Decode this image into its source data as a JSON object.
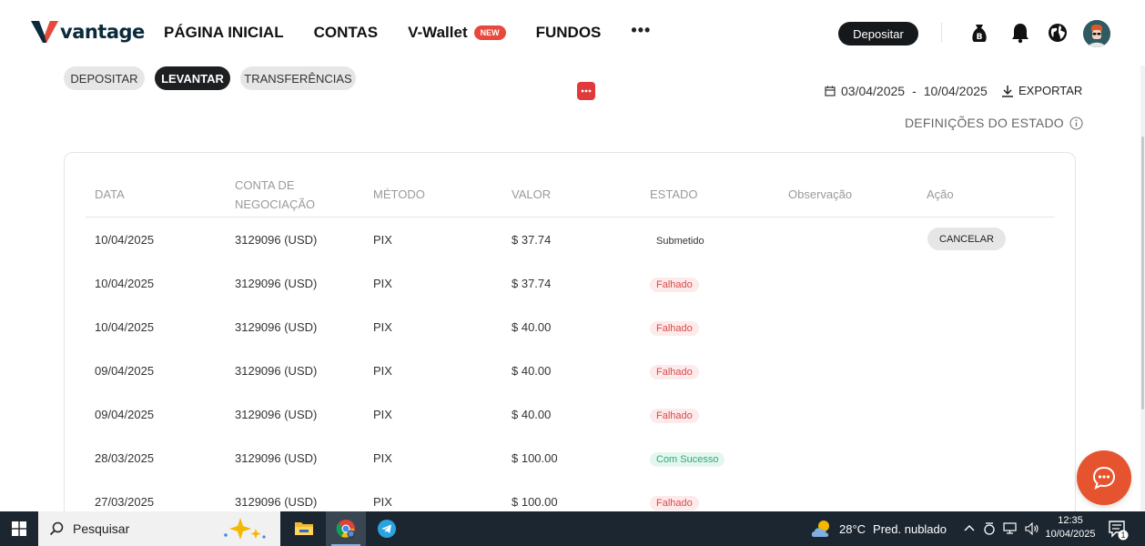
{
  "brand": {
    "logo_text": "vantage",
    "logo_color": "#0b2a3c",
    "accent": "#e8493d"
  },
  "nav": {
    "items": [
      {
        "label": "PÁGINA INICIAL"
      },
      {
        "label": "CONTAS"
      },
      {
        "label": "V-Wallet",
        "badge": "NEW"
      },
      {
        "label": "FUNDOS"
      }
    ],
    "more_label": "•••",
    "deposit_button": "Depositar",
    "icons": [
      "bonus-bag-icon",
      "bell-icon",
      "globe-icon",
      "avatar"
    ]
  },
  "tabs": [
    {
      "label": "DEPOSITAR",
      "active": false
    },
    {
      "label": "LEVANTAR",
      "active": true
    },
    {
      "label": "TRANSFERÊNCIAS",
      "active": false
    }
  ],
  "filters": {
    "date_from": "03/04/2025",
    "date_sep": "-",
    "date_to": "10/04/2025",
    "export_label": "EXPORTAR",
    "status_definitions_label": "DEFINIÇÕES DO ESTADO"
  },
  "table": {
    "headers": {
      "date": "DATA",
      "account_line1": "CONTA DE",
      "account_line2": "NEGOCIAÇÃO",
      "method": "MÉTODO",
      "value": "VALOR",
      "status": "ESTADO",
      "note": "Observação",
      "action": "Ação"
    },
    "cancel_label": "CANCELAR",
    "rows": [
      {
        "date": "10/04/2025",
        "account": "3129096 (USD)",
        "method": "PIX",
        "value": "$ 37.74",
        "status": "Submetido",
        "status_type": "submetido"
      },
      {
        "date": "10/04/2025",
        "account": "3129096 (USD)",
        "method": "PIX",
        "value": "$ 37.74",
        "status": "Falhado",
        "status_type": "falhado"
      },
      {
        "date": "10/04/2025",
        "account": "3129096 (USD)",
        "method": "PIX",
        "value": "$ 40.00",
        "status": "Falhado",
        "status_type": "falhado"
      },
      {
        "date": "09/04/2025",
        "account": "3129096 (USD)",
        "method": "PIX",
        "value": "$ 40.00",
        "status": "Falhado",
        "status_type": "falhado"
      },
      {
        "date": "09/04/2025",
        "account": "3129096 (USD)",
        "method": "PIX",
        "value": "$ 40.00",
        "status": "Falhado",
        "status_type": "falhado"
      },
      {
        "date": "28/03/2025",
        "account": "3129096 (USD)",
        "method": "PIX",
        "value": "$ 100.00",
        "status": "Com Sucesso",
        "status_type": "sucesso"
      },
      {
        "date": "27/03/2025",
        "account": "3129096 (USD)",
        "method": "PIX",
        "value": "$ 100.00",
        "status": "Falhado",
        "status_type": "falhado"
      }
    ]
  },
  "taskbar": {
    "search_placeholder": "Pesquisar",
    "apps": [
      "file-explorer-icon",
      "chrome-icon",
      "telegram-icon"
    ],
    "weather_temp": "28°C",
    "weather_desc": "Pred. nublado",
    "time": "12:35",
    "date": "10/04/2025",
    "notification_count": "1"
  }
}
